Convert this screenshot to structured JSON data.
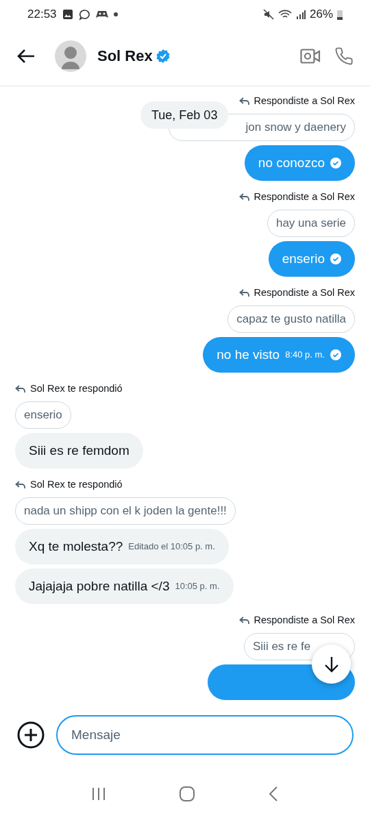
{
  "status_bar": {
    "time": "22:53",
    "battery": "26%"
  },
  "header": {
    "name": "Sol Rex",
    "verified": true
  },
  "date_pill": "Tue, Feb 03",
  "messages": [
    {
      "kind": "sent_reply_label",
      "text": "Respondiste a Sol Rex"
    },
    {
      "kind": "sent_quote",
      "text": "jon snow y daenery"
    },
    {
      "kind": "sent_bubble",
      "text": "no conozco",
      "read": true
    },
    {
      "kind": "sent_reply_label",
      "text": "Respondiste a Sol Rex"
    },
    {
      "kind": "sent_quote",
      "text": "hay una serie"
    },
    {
      "kind": "sent_bubble",
      "text": "enserio",
      "read": true
    },
    {
      "kind": "sent_reply_label",
      "text": "Respondiste a Sol Rex"
    },
    {
      "kind": "sent_quote",
      "text": "capaz te gusto natilla"
    },
    {
      "kind": "sent_bubble",
      "text": "no he visto",
      "time": "8:40 p. m.",
      "read": true
    },
    {
      "kind": "received_reply_label",
      "text": "Sol Rex te respondió"
    },
    {
      "kind": "received_quote",
      "text": "enserio"
    },
    {
      "kind": "received_bubble",
      "text": "Siii es re femdom"
    },
    {
      "kind": "received_reply_label",
      "text": "Sol Rex te respondió"
    },
    {
      "kind": "received_quote",
      "text": "nada un shipp con el k joden la gente!!!"
    },
    {
      "kind": "received_bubble",
      "text": "Xq te molesta??",
      "time": "Editado el 10:05 p. m."
    },
    {
      "kind": "received_bubble",
      "text": "Jajajaja pobre natilla </3",
      "time": "10:05 p. m."
    },
    {
      "kind": "sent_reply_label",
      "text": "Respondiste a Sol Rex"
    },
    {
      "kind": "sent_quote",
      "text": "Siii es re fe"
    },
    {
      "kind": "sent_bubble"
    }
  ],
  "composer": {
    "placeholder": "Mensaje"
  }
}
